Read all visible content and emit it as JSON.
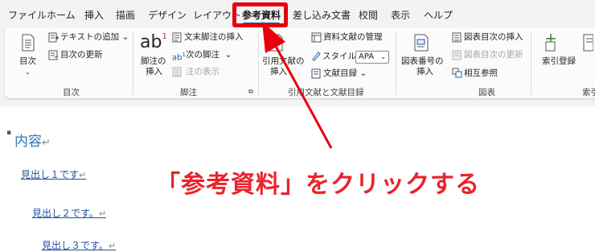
{
  "tabs": [
    "ファイル",
    "ホーム",
    "挿入",
    "描画",
    "デザイン",
    "レイアウト",
    "参考資料",
    "差し込み文書",
    "校閲",
    "表示",
    "ヘルプ"
  ],
  "active_tab": "参考資料",
  "ribbon": {
    "toc": {
      "toc_button": "目次",
      "add_text": "テキストの追加",
      "update_toc": "目次の更新",
      "group_label": "目次"
    },
    "footnotes": {
      "insert_footnote_line1": "脚注の",
      "insert_footnote_line2": "挿入",
      "insert_endnote": "文末脚注の挿入",
      "next_footnote": "次の脚注",
      "show_notes": "注の表示",
      "group_label": "脚注",
      "ab_glyph": "ab",
      "ab_superscript": "1"
    },
    "citations": {
      "insert_citation_line1": "引用文献の",
      "insert_citation_line2": "挿入",
      "manage_sources": "資料文献の管理",
      "style_label": "スタイル:",
      "style_value": "APA",
      "bibliography": "文献目録",
      "group_label": "引用文献と文献目録"
    },
    "captions": {
      "insert_caption_line1": "図表番号の",
      "insert_caption_line2": "挿入",
      "insert_table_of_figures": "図表目次の挿入",
      "update_table": "図表目次の更新",
      "cross_reference": "相互参照",
      "group_label": "図表"
    },
    "index": {
      "mark_entry": "索引登録",
      "group_label_partial": "索引"
    }
  },
  "document": {
    "toc_title": "内容",
    "heading1": "見出し１です",
    "heading2": "見出し２です。",
    "heading3": "見出し３です。",
    "paragraph_mark": "↵"
  },
  "callout": "「参考資料」をクリックする",
  "colors": {
    "highlight": "#e8000b",
    "callout": "#e8242c",
    "link": "#1f4e9c",
    "toc_title": "#2e74b5"
  }
}
